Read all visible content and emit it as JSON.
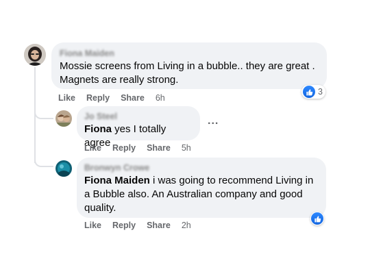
{
  "comments": [
    {
      "author": "Fiona Maiden",
      "text": "Mossie screens from Living in a bubble.. they are great . Magnets are really strong.",
      "actions": {
        "like": "Like",
        "reply": "Reply",
        "share": "Share",
        "time": "6h"
      },
      "reaction": {
        "icon": "thumbs-up-icon",
        "count": "3"
      }
    }
  ],
  "replies": [
    {
      "author": "Jo Steel",
      "mention": "Fiona",
      "text": " yes I totally agree",
      "actions": {
        "like": "Like",
        "reply": "Reply",
        "share": "Share",
        "time": "5h"
      },
      "more": "..."
    },
    {
      "author": "Bronwyn Crowe",
      "mention": "Fiona Maiden",
      "text": " i was going to recommend Living in a Bubble also. An Australian company and good quality.",
      "actions": {
        "like": "Like",
        "reply": "Reply",
        "share": "Share",
        "time": "2h"
      },
      "reaction": {
        "icon": "thumbs-up-icon"
      }
    }
  ],
  "colors": {
    "bubble": "#f0f2f5",
    "meta": "#65676b",
    "like_blue": "#1877f2",
    "thread_line": "#dfe1e5"
  }
}
